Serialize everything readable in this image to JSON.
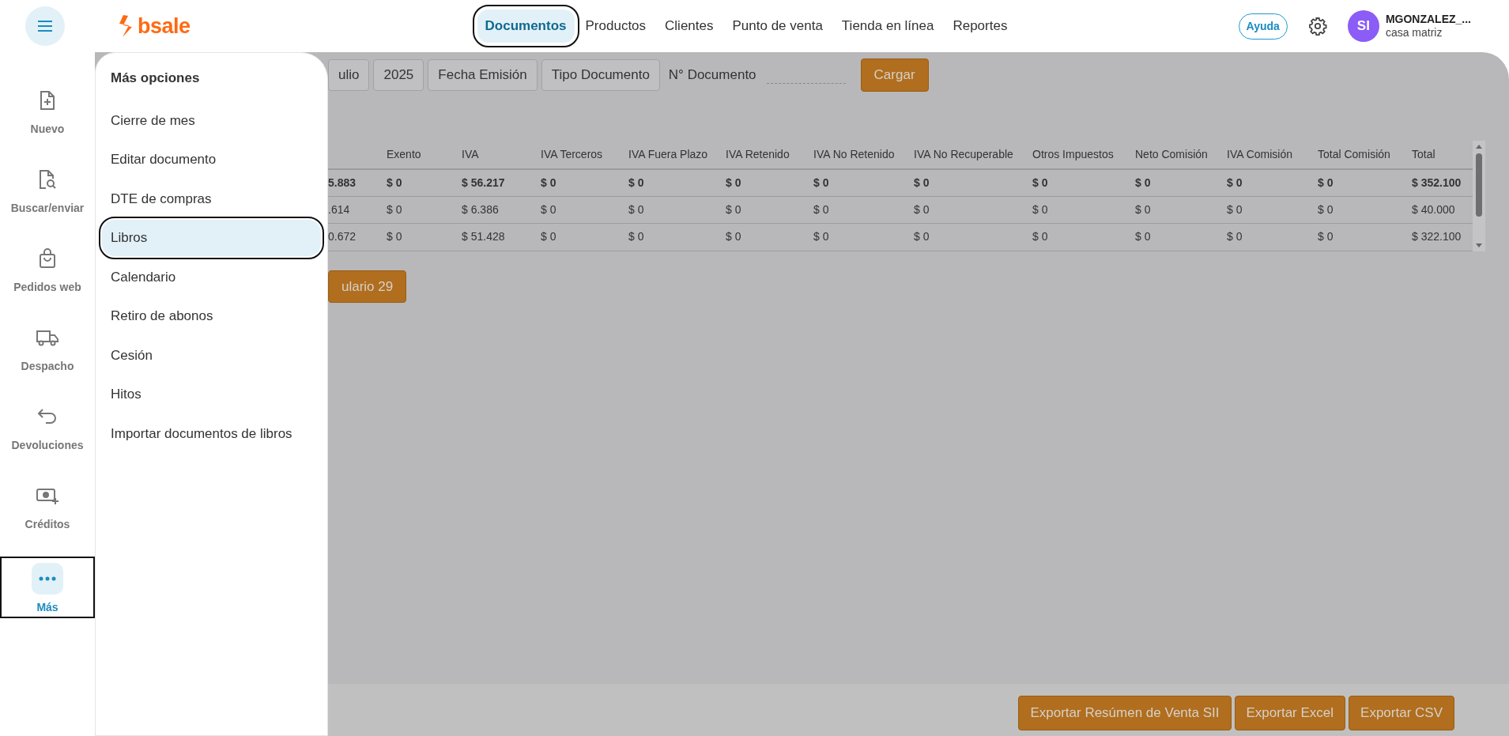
{
  "brand": {
    "name": "bsale"
  },
  "nav": [
    {
      "label": "Documentos",
      "selected": true,
      "outlined": true
    },
    {
      "label": "Productos",
      "selected": false,
      "outlined": false
    },
    {
      "label": "Clientes",
      "selected": false,
      "outlined": false
    },
    {
      "label": "Punto de venta",
      "selected": false,
      "outlined": false
    },
    {
      "label": "Tienda en línea",
      "selected": false,
      "outlined": false
    },
    {
      "label": "Reportes",
      "selected": false,
      "outlined": false
    }
  ],
  "help_button": "Ayuda",
  "user": {
    "initials": "SI",
    "name": "MGONZALEZ_...",
    "branch": "casa matriz"
  },
  "sidebar": {
    "items": [
      {
        "label": "Nuevo",
        "kind": "new",
        "selected": false,
        "outlined": false
      },
      {
        "label": "Buscar/enviar",
        "kind": "search",
        "selected": false,
        "outlined": false
      },
      {
        "label": "Pedidos web",
        "kind": "bag",
        "selected": false,
        "outlined": false
      },
      {
        "label": "Despacho",
        "kind": "truck",
        "selected": false,
        "outlined": false
      },
      {
        "label": "Devoluciones",
        "kind": "return",
        "selected": false,
        "outlined": false
      },
      {
        "label": "Créditos",
        "kind": "cash",
        "selected": false,
        "outlined": false
      },
      {
        "label": "Más",
        "kind": "more",
        "selected": true,
        "outlined": true
      }
    ]
  },
  "menu": {
    "title": "Más opciones",
    "items": [
      {
        "label": "Cierre de mes",
        "selected": false,
        "outlined": false
      },
      {
        "label": "Editar documento",
        "selected": false,
        "outlined": false
      },
      {
        "label": "DTE de compras",
        "selected": false,
        "outlined": false
      },
      {
        "label": "Libros",
        "selected": true,
        "outlined": true
      },
      {
        "label": "Calendario",
        "selected": false,
        "outlined": false
      },
      {
        "label": "Retiro de abonos",
        "selected": false,
        "outlined": false
      },
      {
        "label": "Cesión",
        "selected": false,
        "outlined": false
      },
      {
        "label": "Hitos",
        "selected": false,
        "outlined": false
      },
      {
        "label": "Importar documentos de libros",
        "selected": false,
        "outlined": false
      }
    ]
  },
  "filters": {
    "buttons": [
      "ulio",
      "2025",
      "Fecha Emisión",
      "Tipo Documento"
    ],
    "document_label": "N° Documento",
    "load_button": "Cargar"
  },
  "table": {
    "columns": [
      "",
      "Exento",
      "IVA",
      "IVA Terceros",
      "IVA Fuera Plazo",
      "IVA Retenido",
      "IVA No Retenido",
      "IVA No Recuperable",
      "Otros Impuestos",
      "Neto Comisión",
      "IVA Comisión",
      "Total Comisión",
      "Total"
    ],
    "rows": [
      {
        "kind": "total",
        "cells": [
          "5.883",
          "$ 0",
          "$ 56.217",
          "$ 0",
          "$ 0",
          "$ 0",
          "$ 0",
          "$ 0",
          "$ 0",
          "$ 0",
          "$ 0",
          "$ 0",
          "$ 352.100"
        ]
      },
      {
        "kind": "detail",
        "cells": [
          ".614",
          "$ 0",
          "$ 6.386",
          "$ 0",
          "$ 0",
          "$ 0",
          "$ 0",
          "$ 0",
          "$ 0",
          "$ 0",
          "$ 0",
          "$ 0",
          "$ 40.000"
        ]
      },
      {
        "kind": "detail",
        "cells": [
          "0.672",
          "$ 0",
          "$ 51.428",
          "$ 0",
          "$ 0",
          "$ 0",
          "$ 0",
          "$ 0",
          "$ 0",
          "$ 0",
          "$ 0",
          "$ 0",
          "$ 322.100"
        ]
      }
    ]
  },
  "form_button": "ulario 29",
  "export_buttons": [
    "Exportar Resúmen de Venta SII",
    "Exportar Excel",
    "Exportar CSV"
  ]
}
